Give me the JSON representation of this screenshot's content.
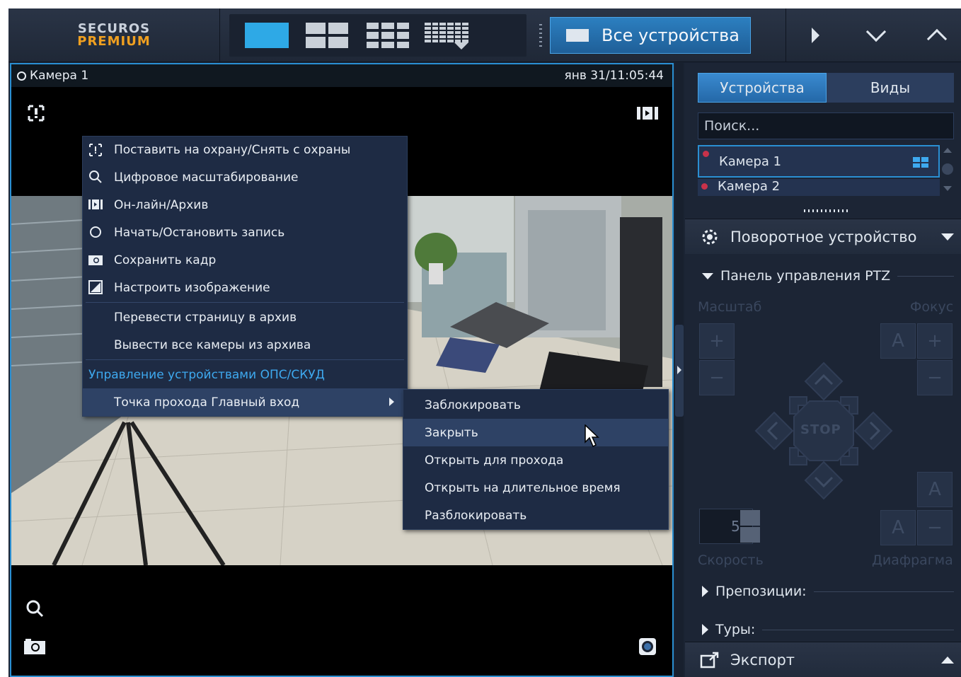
{
  "topbar": {
    "logo_line1": "SECUROS",
    "logo_line2": "PREMIUM",
    "all_devices_label": "Все устройства"
  },
  "camera": {
    "name": "Камера 1",
    "timestamp": "янв 31/11:05:44"
  },
  "context_menu": {
    "items": [
      {
        "label": "Поставить на охрану/Снять с охраны",
        "icon": "arm-icon"
      },
      {
        "label": "Цифровое масштабирование",
        "icon": "zoom-icon"
      },
      {
        "label": "Он-лайн/Архив",
        "icon": "online-archive-icon"
      },
      {
        "label": "Начать/Остановить запись",
        "icon": "record-icon"
      },
      {
        "label": "Сохранить кадр",
        "icon": "camera-snapshot-icon"
      },
      {
        "label": "Настроить изображение",
        "icon": "image-adjust-icon"
      },
      {
        "label": "Перевести страницу в архив"
      },
      {
        "label": "Вывести все камеры из архива"
      }
    ],
    "section_header": "Управление устройствами ОПС/СКУД",
    "submenu_parent": "Точка прохода Главный вход"
  },
  "submenu": {
    "items": [
      "Заблокировать",
      "Закрыть",
      "Открыть для прохода",
      "Открыть на длительное время",
      "Разблокировать"
    ],
    "highlighted_index": 1
  },
  "right_panel": {
    "tab_devices": "Устройства",
    "tab_views": "Виды",
    "search_placeholder": "Поиск...",
    "devices": [
      "Камера 1",
      "Камера 2"
    ],
    "ptz_section": "Поворотное устройство",
    "ptz_panel": "Панель управления PTZ",
    "zoom_label": "Масштаб",
    "focus_label": "Фокус",
    "stop_label": "STOP",
    "speed_value": "5",
    "speed_label": "Скорость",
    "iris_label": "Диафрагма",
    "auto_label": "A",
    "plus": "+",
    "minus": "−",
    "presets": "Препозиции:",
    "tours": "Туры:",
    "export": "Экспорт"
  },
  "colors": {
    "accent": "#2ea9e6",
    "menu_bg": "#1e2b44",
    "header_link": "#3ea9ef",
    "logo_orange": "#f0a020"
  }
}
